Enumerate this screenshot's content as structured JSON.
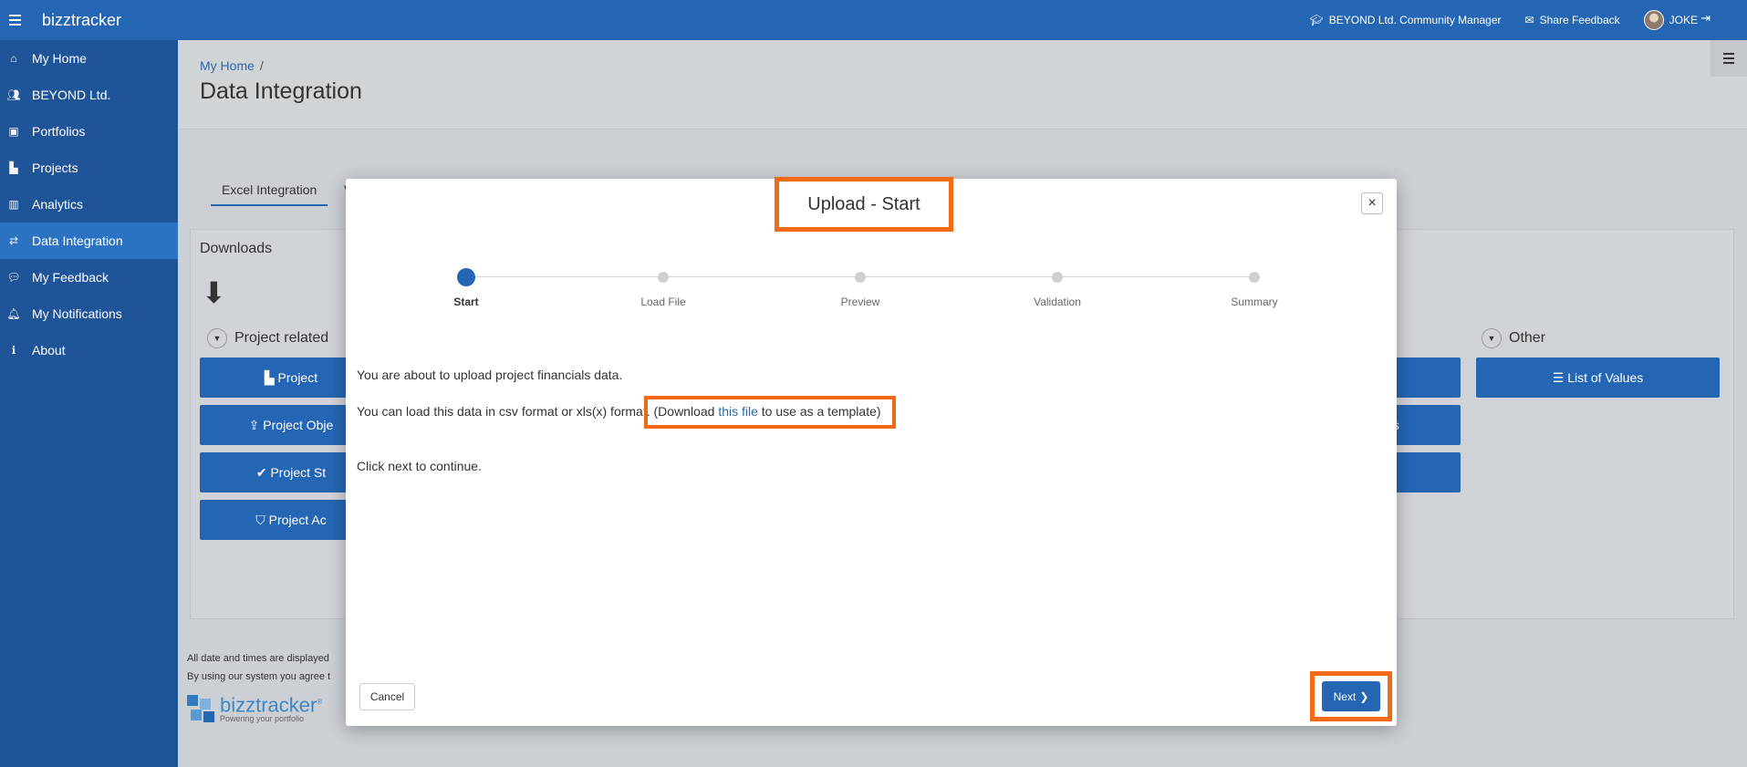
{
  "topbar": {
    "brand": "bizztracker",
    "community": "BEYOND Ltd. Community Manager",
    "feedback": "Share Feedback",
    "user": "JOKE"
  },
  "sidebar": {
    "items": [
      {
        "label": "My Home",
        "icon": "home-icon"
      },
      {
        "label": "BEYOND Ltd.",
        "icon": "users-icon"
      },
      {
        "label": "Portfolios",
        "icon": "briefcase-icon"
      },
      {
        "label": "Projects",
        "icon": "industry-icon"
      },
      {
        "label": "Analytics",
        "icon": "bar-chart-icon"
      },
      {
        "label": "Data Integration",
        "icon": "exchange-icon"
      },
      {
        "label": "My Feedback",
        "icon": "comments-icon"
      },
      {
        "label": "My Notifications",
        "icon": "bell-icon"
      },
      {
        "label": "About",
        "icon": "info-icon"
      }
    ],
    "active_index": 5
  },
  "page": {
    "breadcrumb_home": "My Home",
    "breadcrumb_sep": "/",
    "title": "Data Integration",
    "tabs": [
      "Excel Integration",
      "W"
    ],
    "downloads_title": "Downloads",
    "group_project": "Project related",
    "group_other": "Other",
    "buttons_left": [
      "Project",
      "Project Obje",
      "Project St",
      "Project Ac"
    ],
    "buttons_mid": [
      "",
      "inks",
      "s"
    ],
    "button_other": "List of Values",
    "footer_line1": "All date and times are displayed",
    "footer_line2": "By using our system you agree t",
    "footer_logo": "bizztracker",
    "footer_logo_sub": "Powering your portfolio",
    "footer_logo_reg": "®"
  },
  "modal": {
    "title": "Upload - Start",
    "close": "×",
    "steps": [
      "Start",
      "Load File",
      "Preview",
      "Validation",
      "Summary"
    ],
    "active_step": 0,
    "line1": "You are about to upload project financials data.",
    "line2_pre": "You can load this data in csv format or xls(x) format. (Download ",
    "line2_link": "this file",
    "line2_post": " to use as a template)",
    "line3": "Click next to continue.",
    "cancel": "Cancel",
    "next": "Next"
  },
  "colors": {
    "primary": "#2566b4",
    "sidebar": "#1f5598",
    "highlight": "#f26a16"
  }
}
